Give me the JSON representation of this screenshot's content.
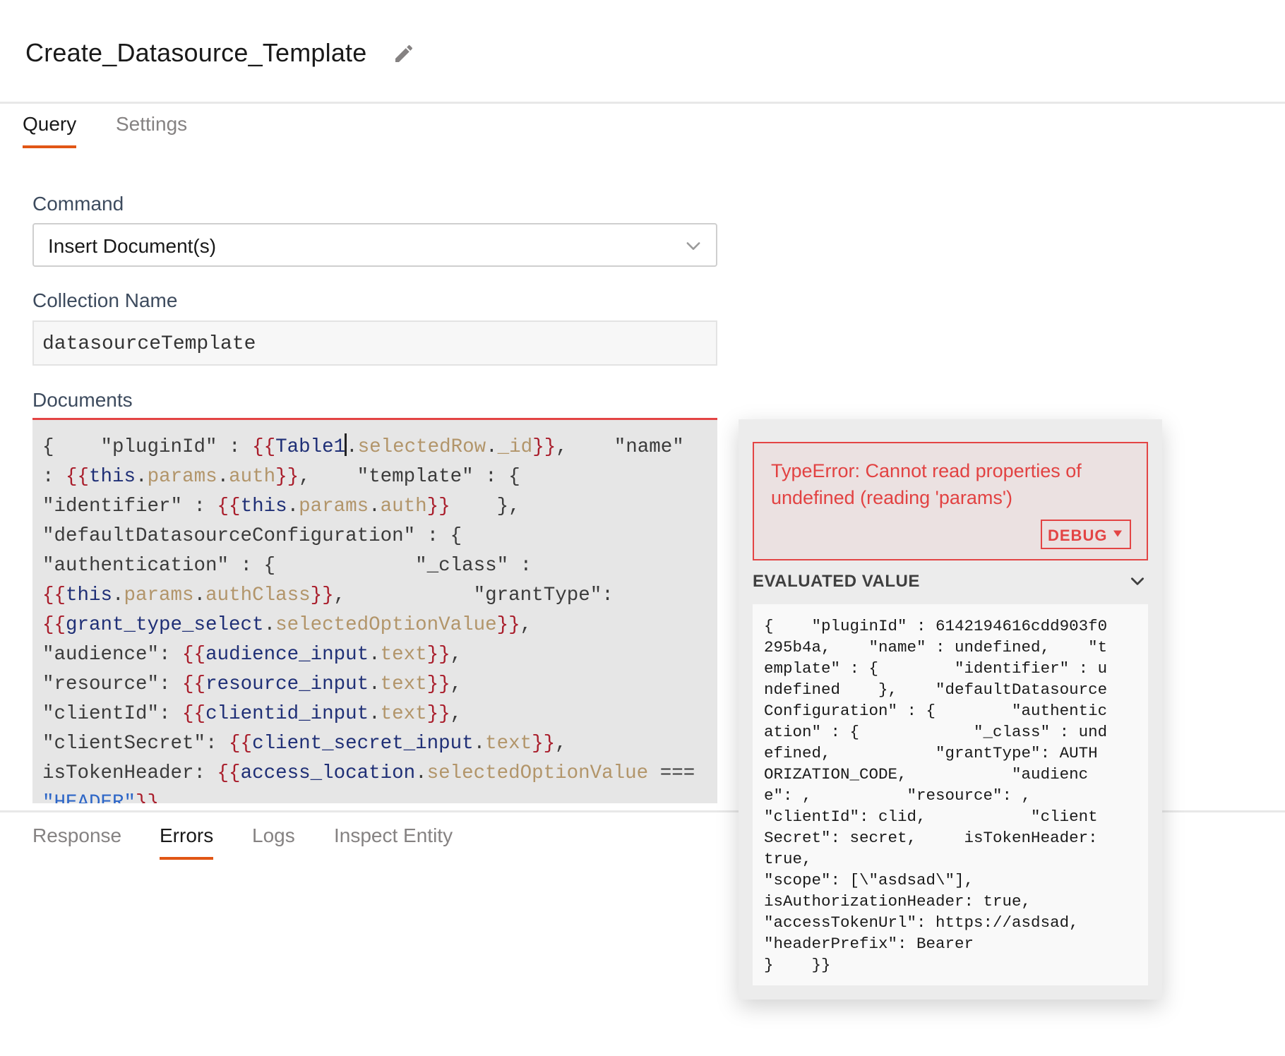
{
  "header": {
    "title": "Create_Datasource_Template"
  },
  "tabs": [
    {
      "label": "Query",
      "active": true
    },
    {
      "label": "Settings",
      "active": false
    }
  ],
  "form": {
    "command_label": "Command",
    "command_value": "Insert Document(s)",
    "collection_label": "Collection Name",
    "collection_value": "datasourceTemplate",
    "documents_label": "Documents"
  },
  "documents_code": [
    "{    \"pluginId\" : {{Table1.selectedRow._id}},    \"name\"",
    ": {{this.params.auth}},    \"template\" : {",
    "\"identifier\" : {{this.params.auth}}    },",
    "\"defaultDatasourceConfiguration\" : {",
    "\"authentication\" : {            \"_class\" :",
    "{{this.params.authClass}},           \"grantType\":",
    "{{grant_type_select.selectedOptionValue}},",
    "\"audience\": {{audience_input.text}},",
    "\"resource\": {{resource_input.text}},",
    "\"clientId\": {{clientid_input.text}},",
    "\"clientSecret\": {{client_secret_input.text}},",
    "isTokenHeader: {{access_location.selectedOptionValue ===",
    "\"HEADER\"}},"
  ],
  "bottom_tabs": [
    {
      "label": "Response",
      "active": false
    },
    {
      "label": "Errors",
      "active": true
    },
    {
      "label": "Logs",
      "active": false
    },
    {
      "label": "Inspect Entity",
      "active": false
    }
  ],
  "popover": {
    "error_message": "TypeError: Cannot read properties of undefined (reading 'params')",
    "debug_label": "DEBUG",
    "evaluated_title": "EVALUATED VALUE",
    "evaluated_value": "{    \"pluginId\" : 6142194616cdd903f0\n295b4a,    \"name\" : undefined,    \"t\nemplate\" : {        \"identifier\" : u\nndefined    },    \"defaultDatasource\nConfiguration\" : {        \"authentic\nation\" : {            \"_class\" : und\nefined,           \"grantType\": AUTH\nORIZATION_CODE,           \"audienc\ne\": ,          \"resource\": ,\n\"clientId\": clid,           \"client\nSecret\": secret,     isTokenHeader:\ntrue,\n\"scope\": [\\\"asdsad\\\"],\nisAuthorizationHeader: true,\n\"accessTokenUrl\": https://asdsad,\n\"headerPrefix\": Bearer\n}    }}"
  },
  "colors": {
    "accent": "#e15615",
    "error": "#e34444",
    "brace": "#a91d2b",
    "identifier": "#1f2f76",
    "property": "#b2956a",
    "string": "#2d66c7"
  },
  "icons": {
    "edit": "pencil-icon",
    "select": "chevron-down-icon",
    "debug": "caret-down-icon",
    "evaluated": "chevron-down-icon"
  }
}
